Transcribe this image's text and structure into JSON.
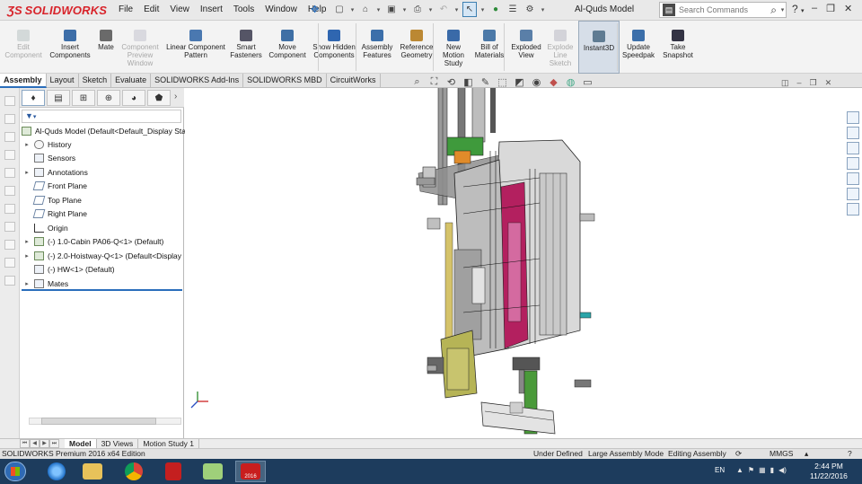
{
  "app": {
    "logo_text": "SOLIDWORKS",
    "document_title": "Al-Quds Model"
  },
  "menu": {
    "items": [
      "File",
      "Edit",
      "View",
      "Insert",
      "Tools",
      "Window",
      "Help"
    ]
  },
  "search": {
    "placeholder": "Search Commands"
  },
  "help_label": "?",
  "command_manager": {
    "commands": [
      {
        "label": "Edit Component",
        "enabled": false,
        "icon": "edit-component-icon"
      },
      {
        "label": "Insert Components",
        "enabled": true,
        "icon": "insert-components-icon"
      },
      {
        "label": "Mate",
        "enabled": true,
        "icon": "mate-icon"
      },
      {
        "label": "Component Preview Window",
        "enabled": false,
        "icon": "component-preview-icon"
      },
      {
        "label": "Linear Component Pattern",
        "enabled": true,
        "icon": "linear-pattern-icon"
      },
      {
        "label": "Smart Fasteners",
        "enabled": true,
        "icon": "smart-fasteners-icon"
      },
      {
        "label": "Move Component",
        "enabled": true,
        "icon": "move-component-icon"
      },
      {
        "label": "Show Hidden Components",
        "enabled": true,
        "icon": "show-hidden-icon"
      },
      {
        "label": "Assembly Features",
        "enabled": true,
        "icon": "assembly-features-icon"
      },
      {
        "label": "Reference Geometry",
        "enabled": true,
        "icon": "reference-geometry-icon"
      },
      {
        "label": "New Motion Study",
        "enabled": true,
        "icon": "motion-study-icon"
      },
      {
        "label": "Bill of Materials",
        "enabled": true,
        "icon": "bom-icon"
      },
      {
        "label": "Exploded View",
        "enabled": true,
        "icon": "exploded-view-icon"
      },
      {
        "label": "Explode Line Sketch",
        "enabled": false,
        "icon": "explode-line-icon"
      },
      {
        "label": "Instant3D",
        "enabled": true,
        "active": true,
        "icon": "instant3d-icon"
      },
      {
        "label": "Update Speedpak",
        "enabled": true,
        "icon": "speedpak-icon"
      },
      {
        "label": "Take Snapshot",
        "enabled": true,
        "icon": "snapshot-icon"
      }
    ]
  },
  "cm_tabs": [
    "Assembly",
    "Layout",
    "Sketch",
    "Evaluate",
    "SOLIDWORKS Add-Ins",
    "SOLIDWORKS MBD",
    "CircuitWorks"
  ],
  "active_cm_tab": "Assembly",
  "feature_tree": {
    "root": "Al-Quds Model  (Default<Default_Display State-1>)",
    "items": [
      {
        "label": "History",
        "expandable": true,
        "icon": "history-icon"
      },
      {
        "label": "Sensors",
        "expandable": false,
        "icon": "sensors-icon"
      },
      {
        "label": "Annotations",
        "expandable": true,
        "icon": "annotations-icon"
      },
      {
        "label": "Front Plane",
        "expandable": false,
        "icon": "plane-icon"
      },
      {
        "label": "Top Plane",
        "expandable": false,
        "icon": "plane-icon"
      },
      {
        "label": "Right Plane",
        "expandable": false,
        "icon": "plane-icon"
      },
      {
        "label": "Origin",
        "expandable": false,
        "icon": "origin-icon"
      },
      {
        "label": "(-) 1.0-Cabin PA06-Q<1> (Default)",
        "expandable": true,
        "icon": "subassembly-icon"
      },
      {
        "label": "(-) 2.0-Hoistway-Q<1> (Default<Display",
        "expandable": true,
        "icon": "subassembly-icon"
      },
      {
        "label": "(-) HW<1> (Default)",
        "expandable": false,
        "icon": "part-icon"
      },
      {
        "label": "Mates",
        "expandable": true,
        "icon": "mates-icon"
      }
    ]
  },
  "bottom_tabs": [
    "Model",
    "3D Views",
    "Motion Study 1"
  ],
  "active_bottom_tab": "Model",
  "status_bar": {
    "edition": "SOLIDWORKS Premium 2016 x64 Edition",
    "state": "Under Defined",
    "mode": "Large Assembly Mode",
    "editing": "Editing Assembly",
    "units": "MMGS"
  },
  "taskbar": {
    "language": "EN",
    "time": "2:44 PM",
    "date": "11/22/2016",
    "sw_badge": "2016",
    "apps": [
      "start-icon",
      "internet-explorer-icon",
      "file-explorer-icon",
      "chrome-icon",
      "pdf-icon",
      "folder-icon",
      "solidworks-icon"
    ]
  },
  "colors": {
    "brand_red": "#d8232a",
    "accent_blue": "#2a6ebb",
    "taskbar": "#1d3c5d",
    "model_magenta": "#b3205f",
    "model_olive": "#b6b456",
    "model_green": "#4a9a3a"
  }
}
